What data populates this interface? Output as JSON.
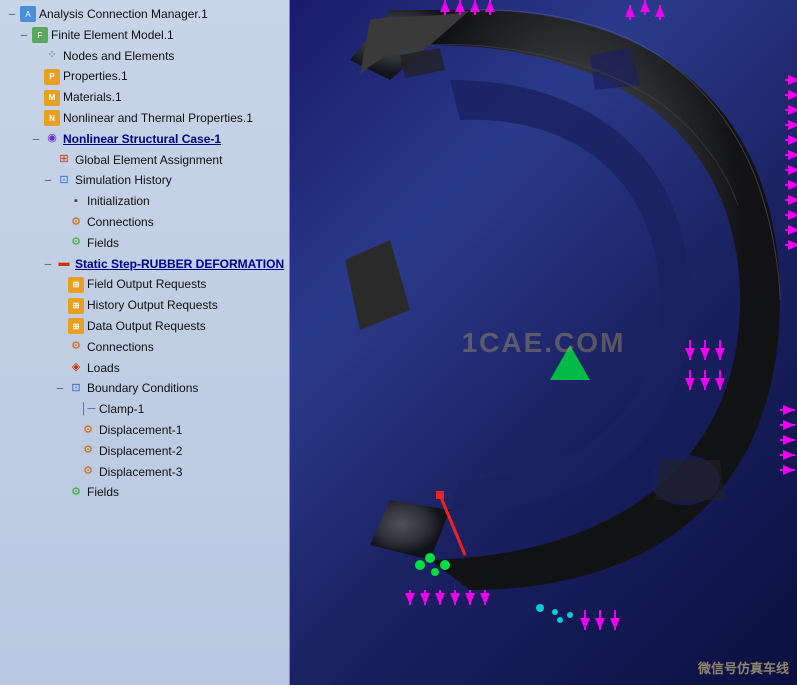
{
  "tree": {
    "items": [
      {
        "id": "analysis-connection",
        "label": "Analysis Connection Manager.1",
        "indent": 0,
        "expand": "-",
        "icon": "analysis",
        "underline": false
      },
      {
        "id": "finite-element",
        "label": "Finite Element Model.1",
        "indent": 1,
        "expand": "-",
        "icon": "fem",
        "underline": false
      },
      {
        "id": "nodes-elements",
        "label": "Nodes and Elements",
        "indent": 2,
        "expand": "",
        "icon": "nodes",
        "underline": false
      },
      {
        "id": "properties",
        "label": "Properties.1",
        "indent": 2,
        "expand": "",
        "icon": "prop",
        "underline": false
      },
      {
        "id": "materials",
        "label": "Materials.1",
        "indent": 2,
        "expand": "",
        "icon": "mat",
        "underline": false
      },
      {
        "id": "nonlinear-thermal",
        "label": "Nonlinear and Thermal Properties.1",
        "indent": 2,
        "expand": "",
        "icon": "nonlin",
        "underline": false
      },
      {
        "id": "nonlinear-case",
        "label": "Nonlinear Structural Case-1",
        "indent": 2,
        "expand": "-",
        "icon": "case",
        "underline": true
      },
      {
        "id": "global-element",
        "label": "Global Element Assignment",
        "indent": 3,
        "expand": "",
        "icon": "global",
        "underline": false
      },
      {
        "id": "simulation-history",
        "label": "Simulation History",
        "indent": 3,
        "expand": "-",
        "icon": "sim",
        "underline": false
      },
      {
        "id": "initialization",
        "label": "Initialization",
        "indent": 4,
        "expand": "",
        "icon": "init",
        "underline": false
      },
      {
        "id": "connections-1",
        "label": "Connections",
        "indent": 4,
        "expand": "",
        "icon": "conn",
        "underline": false
      },
      {
        "id": "fields-1",
        "label": "Fields",
        "indent": 4,
        "expand": "",
        "icon": "field",
        "underline": false
      },
      {
        "id": "static-step",
        "label": "Static Step-RUBBER DEFORMATION",
        "indent": 3,
        "expand": "-",
        "icon": "static",
        "underline": true
      },
      {
        "id": "field-output",
        "label": "Field Output Requests",
        "indent": 4,
        "expand": "",
        "icon": "output",
        "underline": false
      },
      {
        "id": "history-output",
        "label": "History Output Requests",
        "indent": 4,
        "expand": "",
        "icon": "output",
        "underline": false
      },
      {
        "id": "data-output",
        "label": "Data Output Requests",
        "indent": 4,
        "expand": "",
        "icon": "output",
        "underline": false
      },
      {
        "id": "connections-2",
        "label": "Connections",
        "indent": 4,
        "expand": "",
        "icon": "conn",
        "underline": false
      },
      {
        "id": "loads",
        "label": "Loads",
        "indent": 4,
        "expand": "",
        "icon": "load",
        "underline": false
      },
      {
        "id": "boundary-conditions",
        "label": "Boundary Conditions",
        "indent": 4,
        "expand": "-",
        "icon": "bc",
        "underline": false
      },
      {
        "id": "clamp-1",
        "label": "Clamp-1",
        "indent": 5,
        "expand": "",
        "icon": "clamp",
        "underline": false
      },
      {
        "id": "displacement-1",
        "label": "Displacement-1",
        "indent": 5,
        "expand": "",
        "icon": "disp",
        "underline": false
      },
      {
        "id": "displacement-2",
        "label": "Displacement-2",
        "indent": 5,
        "expand": "",
        "icon": "disp",
        "underline": false
      },
      {
        "id": "displacement-3",
        "label": "Displacement-3",
        "indent": 5,
        "expand": "",
        "icon": "disp",
        "underline": false
      },
      {
        "id": "fields-2",
        "label": "Fields",
        "indent": 4,
        "expand": "",
        "icon": "field",
        "underline": false
      }
    ]
  },
  "watermark": "1CAE.COM",
  "bottom_watermark": "微信号仿真车线",
  "icons": {
    "analysis": "A",
    "fem": "F",
    "prop": "P",
    "mat": "M",
    "nonlin": "N",
    "case": "◉",
    "global": "⊠",
    "sim": "⊡",
    "init": "─",
    "conn": "⚙",
    "field": "⚙",
    "static": "─",
    "output": "⚙",
    "load": "⚙",
    "bc": "⊡",
    "clamp": "│",
    "disp": "⚙",
    "nodes": "·"
  }
}
